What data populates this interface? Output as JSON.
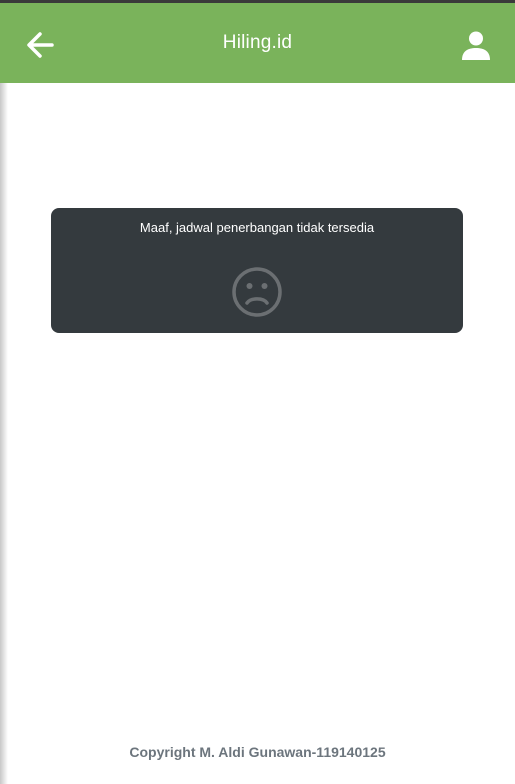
{
  "header": {
    "title": "Hiling.id",
    "back_icon": "arrow-left-icon",
    "profile_icon": "user-icon",
    "background_color": "#7ab35b"
  },
  "notice": {
    "message": "Maaf, jadwal penerbangan tidak tersedia",
    "icon": "sad-face-icon",
    "background_color": "#343a3e"
  },
  "footer": {
    "copyright": "Copyright M. Aldi Gunawan-119140125"
  }
}
